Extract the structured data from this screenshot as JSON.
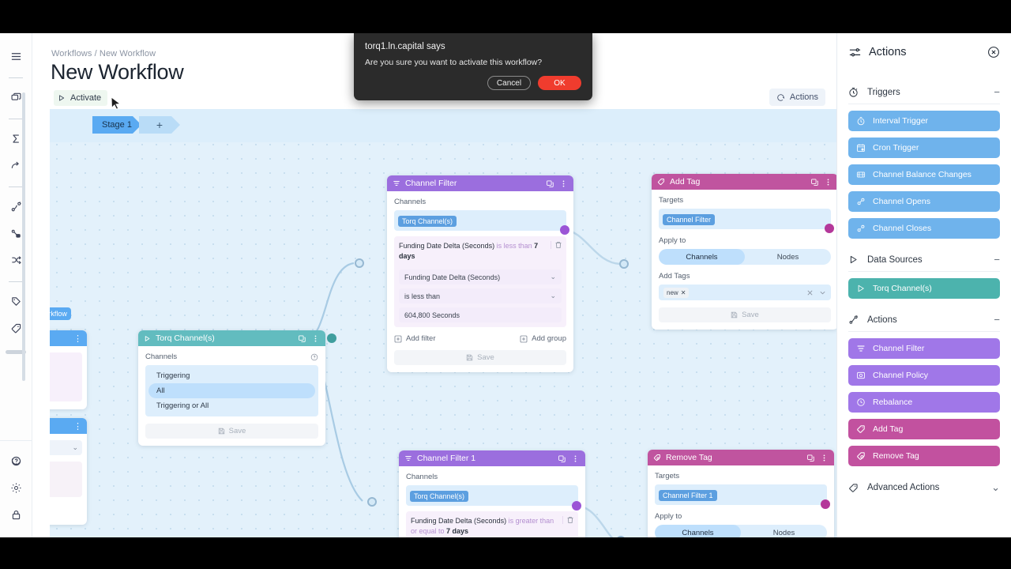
{
  "dialog": {
    "title": "torq1.ln.capital says",
    "message": "Are you sure you want to activate this workflow?",
    "cancel_label": "Cancel",
    "ok_label": "OK",
    "ok_color": "#f03c2e"
  },
  "header": {
    "breadcrumb": "Workflows / New Workflow",
    "page_title": "New Workflow",
    "activate_label": "Activate",
    "actions_toolbar_label": "Actions"
  },
  "canvas": {
    "stage_label": "Stage 1",
    "add_stage_label": "+"
  },
  "nodes": [
    {
      "id": "torq-channels",
      "title": "Torq Channel(s)",
      "head_color": "#62bcbf",
      "icon": "play-icon",
      "channels_label": "Channels",
      "options": [
        "Triggering",
        "All",
        "Triggering or All"
      ],
      "selected": "All",
      "save_label": "Save"
    },
    {
      "id": "channel-filter",
      "title": "Channel Filter",
      "head_color": "#9b6ede",
      "icon": "filter-icon",
      "channels_label": "Channels",
      "channel_chip": "Torq Channel(s)",
      "filter_field": "Funding Date Delta (Seconds)",
      "filter_operator": "is less than",
      "filter_value_human": "7 days",
      "filter_value": "604,800 Seconds",
      "add_filter_label": "Add filter",
      "add_group_label": "Add group",
      "save_label": "Save"
    },
    {
      "id": "add-tag",
      "title": "Add Tag",
      "head_color": "#c0549f",
      "icon": "tag-icon",
      "targets_label": "Targets",
      "target_chip": "Channel Filter",
      "apply_to_label": "Apply to",
      "apply_options": [
        "Channels",
        "Nodes"
      ],
      "apply_selected": "Channels",
      "add_tags_label": "Add Tags",
      "tags": [
        "new"
      ],
      "save_label": "Save"
    },
    {
      "id": "channel-filter-1",
      "title": "Channel Filter 1",
      "head_color": "#9b6ede",
      "icon": "filter-icon",
      "channels_label": "Channels",
      "channel_chip": "Torq Channel(s)",
      "filter_field": "Funding Date Delta (Seconds)",
      "filter_operator": "is greater than or equal to",
      "filter_value_human": "7 days"
    },
    {
      "id": "remove-tag",
      "title": "Remove Tag",
      "head_color": "#c0549f",
      "icon": "remove-tag-icon",
      "targets_label": "Targets",
      "target_chip": "Channel Filter 1",
      "apply_to_label": "Apply to",
      "apply_options": [
        "Channels",
        "Nodes"
      ],
      "apply_selected": "Channels"
    }
  ],
  "right_panel": {
    "title": "Actions",
    "sections": [
      {
        "name": "Triggers",
        "toggle": "−",
        "items": [
          {
            "label": "Interval Trigger",
            "color": "#6fb3ec",
            "icon": "timer-icon"
          },
          {
            "label": "Cron Trigger",
            "color": "#6fb3ec",
            "icon": "calendar-clock-icon"
          },
          {
            "label": "Channel Balance Changes",
            "color": "#6fb3ec",
            "icon": "balance-icon"
          },
          {
            "label": "Channel Opens",
            "color": "#6fb3ec",
            "icon": "link-icon"
          },
          {
            "label": "Channel Closes",
            "color": "#6fb3ec",
            "icon": "link-broken-icon"
          }
        ]
      },
      {
        "name": "Data Sources",
        "toggle": "−",
        "items": [
          {
            "label": "Torq Channel(s)",
            "color": "#4cb3ad",
            "icon": "play-icon"
          }
        ]
      },
      {
        "name": "Actions",
        "toggle": "−",
        "items": [
          {
            "label": "Channel Filter",
            "color": "#a077e8",
            "icon": "filter-icon"
          },
          {
            "label": "Channel Policy",
            "color": "#a077e8",
            "icon": "policy-icon"
          },
          {
            "label": "Rebalance",
            "color": "#a077e8",
            "icon": "rebalance-icon"
          },
          {
            "label": "Add Tag",
            "color": "#c2519f",
            "icon": "tag-icon"
          },
          {
            "label": "Remove Tag",
            "color": "#c2519f",
            "icon": "remove-tag-icon"
          }
        ]
      },
      {
        "name": "Advanced Actions",
        "toggle": "⌄",
        "items": []
      }
    ]
  },
  "rail": {
    "icons": [
      "menu-icon",
      "copy-icon",
      "sigma-icon",
      "forward-arrow-icon",
      "route-icon",
      "workflow-icon",
      "shuffle-icon",
      "tag-outline-icon",
      "tag-icon",
      "help-icon",
      "gear-icon",
      "lock-icon"
    ]
  }
}
